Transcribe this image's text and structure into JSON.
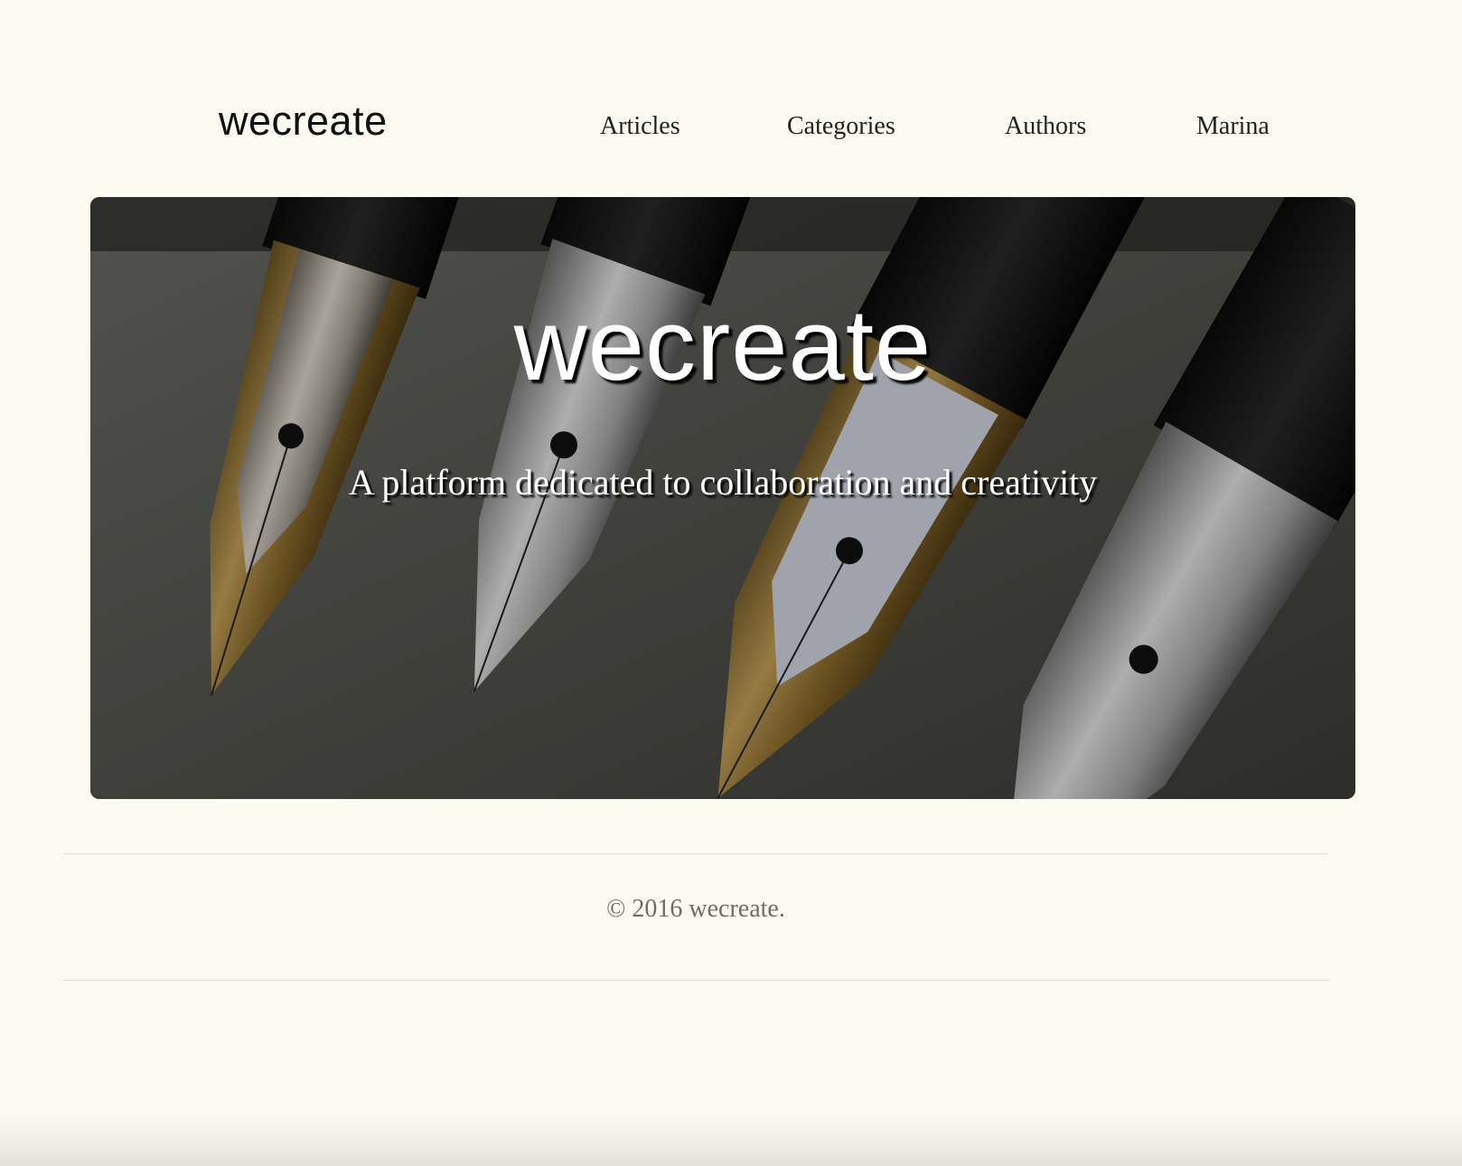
{
  "header": {
    "brand": "wecreate",
    "nav": [
      "Articles",
      "Categories",
      "Authors",
      "Marina"
    ]
  },
  "hero": {
    "title": "wecreate",
    "subtitle": "A platform dedicated to collaboration and creativity",
    "image_description_icon": "fountain-pen-nibs-image"
  },
  "footer": {
    "copyright": "© 2016 wecreate."
  },
  "colors": {
    "background": "#fafaf0",
    "text": "#111111",
    "footer_text": "#6e6e68"
  }
}
